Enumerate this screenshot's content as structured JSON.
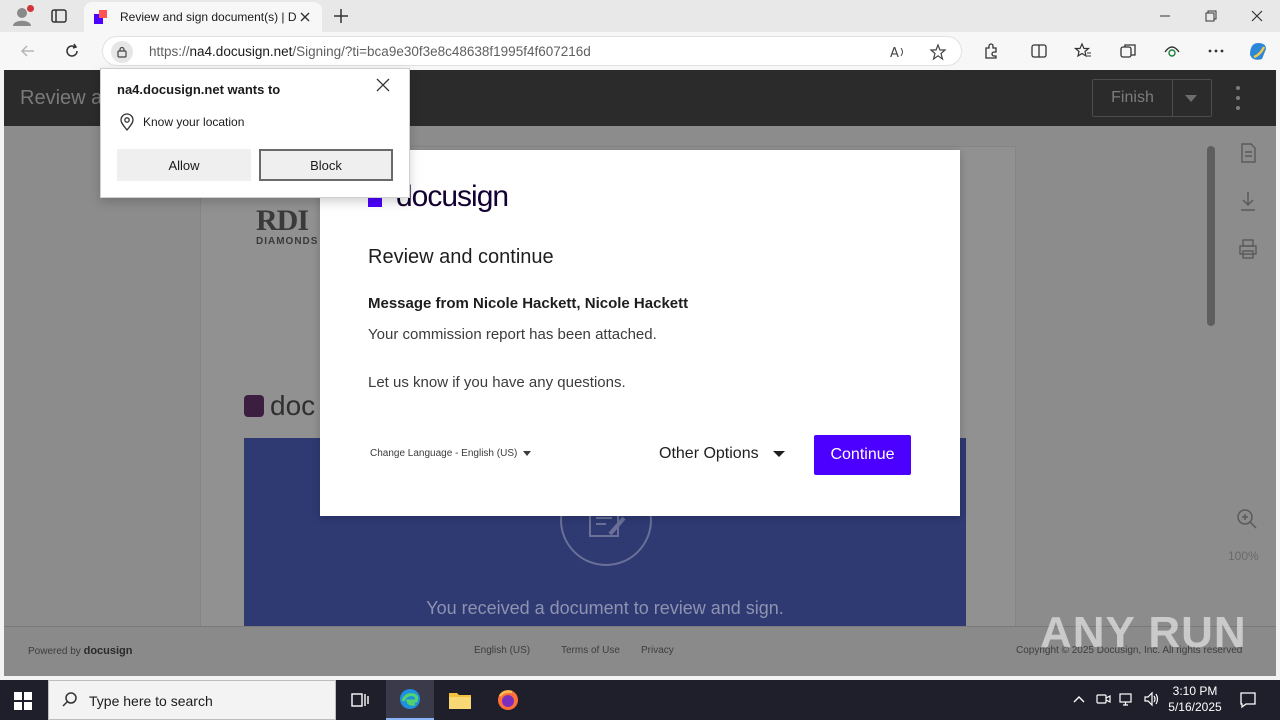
{
  "browser": {
    "tab_title": "Review and sign document(s) | D",
    "url_host": "na4.docusign.net",
    "url_prefix": "https://",
    "url_path": "/Signing/?ti=bca9e30f3e8c48638f1995f4f607216d"
  },
  "permission_popup": {
    "title": "na4.docusign.net wants to",
    "permission": "Know your location",
    "allow_label": "Allow",
    "block_label": "Block"
  },
  "signing_page": {
    "header_title": "Review a",
    "finish_label": "Finish",
    "zoom_level": "100%",
    "document": {
      "company_logo": "RDI",
      "company_sub": "DIAMONDS",
      "docusign_text": "doc",
      "received_message": "You received a document to review and sign."
    },
    "footer": {
      "powered_by": "Powered by",
      "powered_brand": "docusign",
      "language": "English (US)",
      "terms": "Terms of Use",
      "privacy": "Privacy",
      "copyright": "Copyright © 2025 Docusign, Inc. All rights reserved"
    }
  },
  "modal": {
    "brand": "docusign",
    "heading": "Review and continue",
    "from": "Message from Nicole Hackett, Nicole Hackett",
    "line1": "Your commission report has been attached.",
    "line2": "Let us know if you have any questions.",
    "change_language": "Change Language - English (US)",
    "other_options": "Other Options",
    "continue_label": "Continue"
  },
  "watermark": "ANY RUN",
  "taskbar": {
    "search_placeholder": "Type here to search",
    "time": "3:10 PM",
    "date": "5/16/2025"
  },
  "colors": {
    "docusign_purple": "#4c00ff",
    "docusign_red": "#ff5252"
  }
}
